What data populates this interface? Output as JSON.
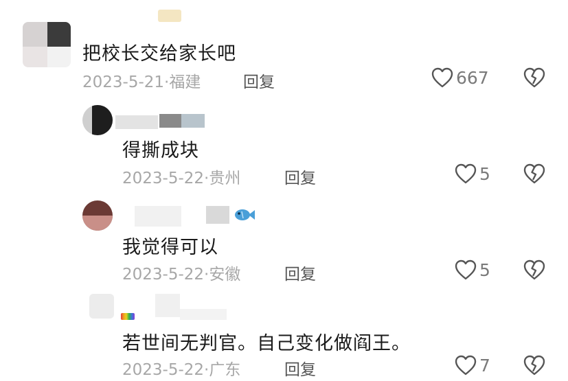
{
  "comments": [
    {
      "text": "把校长交给家长吧",
      "date": "2023-5-21",
      "location": "福建",
      "reply_label": "回复",
      "likes": "667"
    },
    {
      "text": "得撕成块",
      "date": "2023-5-22",
      "location": "贵州",
      "reply_label": "回复",
      "likes": "5"
    },
    {
      "text": "我觉得可以",
      "date": "2023-5-22",
      "location": "安徽",
      "reply_label": "回复",
      "likes": "5"
    },
    {
      "text": "若世间无判官。自己变化做阎王。",
      "date": "2023-5-22",
      "location": "广东",
      "reply_label": "回复",
      "likes": "7"
    }
  ],
  "meta_separator": "·",
  "icons": {
    "like": "heart-outline-icon",
    "dislike": "broken-heart-icon"
  }
}
